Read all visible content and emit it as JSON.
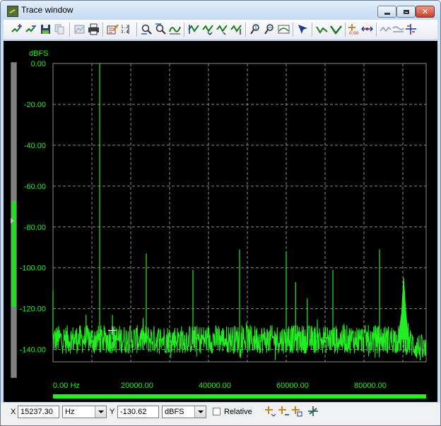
{
  "window": {
    "title": "Trace window"
  },
  "toolbar": {
    "buttons": [
      "zoom-in-icon",
      "zoom-out-icon",
      "save-trace-icon",
      "copy-icon",
      "image-icon",
      "print-icon",
      "edit-icon",
      "data-table-icon",
      "zoom-x-icon",
      "zoom-y-icon",
      "auto-scale-icon",
      "trace-a-icon",
      "trace-b-icon",
      "trace-c-icon",
      "trace-d-icon",
      "marker-icon",
      "marker-relative-icon",
      "peak-icon",
      "cursor-move-icon",
      "line-icon",
      "dot-icon",
      "fit-icon",
      "trace-cycle-icon",
      "wave-icon",
      "stack-icon"
    ]
  },
  "plot": {
    "y_unit_label": "dBFS",
    "background": "#000000",
    "trace_color": "#22ee22",
    "grid_color": "#8a8a8a",
    "x_start_label": "0.00 Hz"
  },
  "chart_data": {
    "type": "line",
    "title": "",
    "xlabel": "Hz",
    "ylabel": "dBFS",
    "xlim": [
      0,
      96000
    ],
    "ylim": [
      -145,
      0
    ],
    "x_ticks": [
      0,
      20000,
      40000,
      60000,
      80000
    ],
    "x_tick_labels": [
      "0.00 Hz",
      "20000.00",
      "40000.00",
      "60000.00",
      "80000.00"
    ],
    "y_ticks": [
      0,
      -20,
      -40,
      -60,
      -80,
      -100,
      -120,
      -140
    ],
    "y_tick_labels": [
      "0.00",
      "-20.00",
      "-40.00",
      "-60.00",
      "-80.00",
      "-100.00",
      "-120.00",
      "-140.00"
    ],
    "grid": true,
    "noise_floor_db": -135,
    "peaks": [
      {
        "x": 0,
        "y": -111
      },
      {
        "x": 8500,
        "y": -123
      },
      {
        "x": 12000,
        "y": 0
      },
      {
        "x": 15300,
        "y": -123
      },
      {
        "x": 24000,
        "y": -93
      },
      {
        "x": 36000,
        "y": -101
      },
      {
        "x": 48000,
        "y": -91
      },
      {
        "x": 60000,
        "y": -92
      },
      {
        "x": 62400,
        "y": -107
      },
      {
        "x": 65400,
        "y": -115
      },
      {
        "x": 72000,
        "y": -101
      },
      {
        "x": 84000,
        "y": -91
      },
      {
        "x": 90200,
        "y": -105
      }
    ],
    "cursor": {
      "x": 15237.3,
      "y": -130.62
    }
  },
  "bottombar": {
    "x_label": "X",
    "x_value": "15237.30",
    "x_unit": "Hz",
    "y_label": "Y",
    "y_value": "-130.62",
    "y_unit": "dBFS",
    "relative_label": "Relative",
    "relative_checked": false,
    "icons": [
      "add-marker-icon",
      "move-marker-icon",
      "peak-marker-icon",
      "delta-marker-icon"
    ]
  }
}
